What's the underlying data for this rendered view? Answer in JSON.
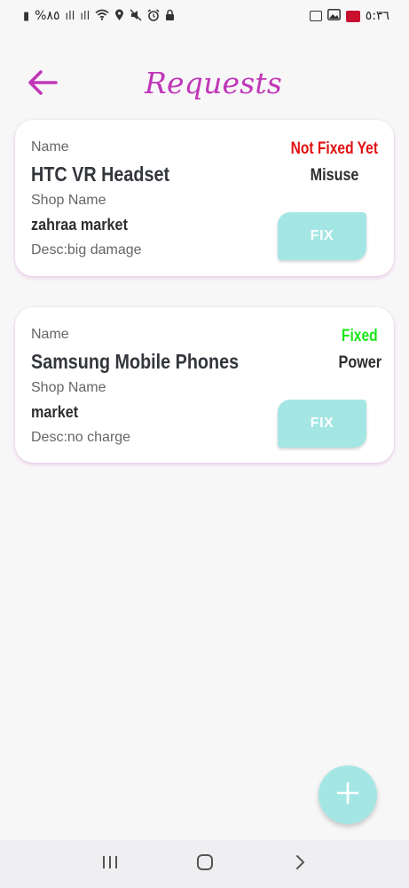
{
  "status_bar": {
    "left_text": "%٨٥",
    "right_time": "٥:٣٦"
  },
  "header": {
    "title": "Requests"
  },
  "requests": [
    {
      "name_label": "Name",
      "name": "HTC VR Headset",
      "shop_label": "Shop Name",
      "shop": "zahraa market",
      "desc": "Desc:big damage",
      "status": "Not Fixed Yet",
      "type": "Misuse",
      "button_label": "FIX"
    },
    {
      "name_label": "Name",
      "name": "Samsung Mobile Phones",
      "shop_label": "Shop Name",
      "shop": "market",
      "desc": "Desc:no charge",
      "status": "Fixed",
      "type": "Power",
      "button_label": "FIX"
    }
  ],
  "colors": {
    "accent": "#c036b8",
    "button": "#a4e6e4",
    "not_fixed": "#e31111",
    "fixed": "#19e619"
  },
  "icons": {
    "back": "arrow-left-icon",
    "fab": "plus-icon",
    "nav": [
      "recent-apps-icon",
      "home-icon",
      "back-chevron-icon"
    ]
  }
}
